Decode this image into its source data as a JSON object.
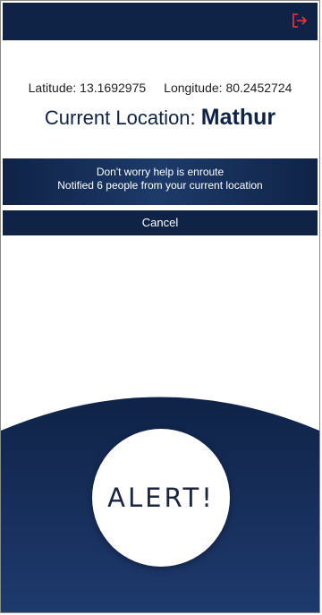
{
  "header": {
    "logout_icon": "logout-icon"
  },
  "coords": {
    "latitude": "Latitude: 13.1692975",
    "longitude": "Longitude: 80.2452724"
  },
  "location": {
    "prefix": "Current Location:",
    "city": "Mathur"
  },
  "notice": {
    "line1": "Don't worry help is enroute",
    "line2": "Notified 6 people from your current location"
  },
  "cancel_label": "Cancel",
  "alert_label": "ALERT!",
  "colors": {
    "navy": "#0f2347",
    "logout_icon": "#e53935"
  }
}
